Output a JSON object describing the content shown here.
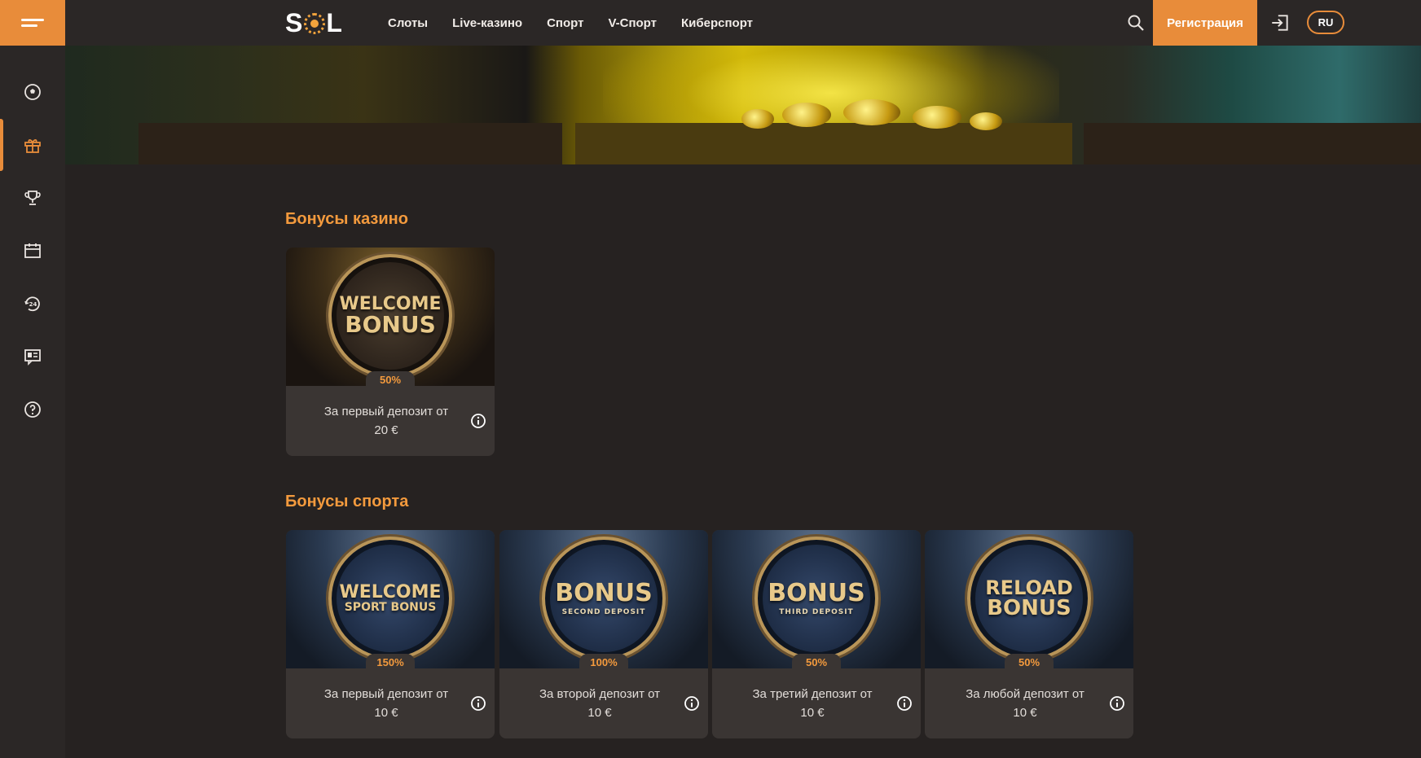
{
  "header": {
    "logo_text": "SOL",
    "nav": [
      "Слоты",
      "Live-казино",
      "Спорт",
      "V-Спорт",
      "Киберспорт"
    ],
    "register_label": "Регистрация",
    "lang_label": "RU"
  },
  "sidebar": {
    "icons": [
      "soccer-ball-icon",
      "gift-icon",
      "trophy-icon",
      "calendar-icon",
      "support-24-icon",
      "chat-icon",
      "help-icon"
    ],
    "active_index": 1
  },
  "colors": {
    "accent": "#e88c3a",
    "title": "#f39a3d",
    "bg": "#262221",
    "panel": "#2b2726",
    "card": "#3a3533"
  },
  "casino": {
    "title": "Бонусы казино",
    "cards": [
      {
        "medal_big": "WELCOME",
        "medal_big2": "BONUS",
        "medal_sub": "",
        "percent": "50%",
        "desc_line1": "За первый депозит от",
        "desc_line2": "20 €"
      }
    ]
  },
  "sport": {
    "title": "Бонусы спорта",
    "cards": [
      {
        "medal_big": "WELCOME",
        "medal_big2": "SPORT BONUS",
        "medal_sub": "",
        "percent": "150%",
        "desc_line1": "За первый депозит от",
        "desc_line2": "10 €"
      },
      {
        "medal_big": "BONUS",
        "medal_big2": "",
        "medal_sub": "SECOND DEPOSIT",
        "percent": "100%",
        "desc_line1": "За второй депозит от",
        "desc_line2": "10 €"
      },
      {
        "medal_big": "BONUS",
        "medal_big2": "",
        "medal_sub": "THIRD DEPOSIT",
        "percent": "50%",
        "desc_line1": "За третий депозит от",
        "desc_line2": "10 €"
      },
      {
        "medal_big": "RELOAD",
        "medal_big2": "BONUS",
        "medal_sub": "",
        "percent": "50%",
        "desc_line1": "За любой депозит от",
        "desc_line2": "10 €"
      }
    ]
  }
}
